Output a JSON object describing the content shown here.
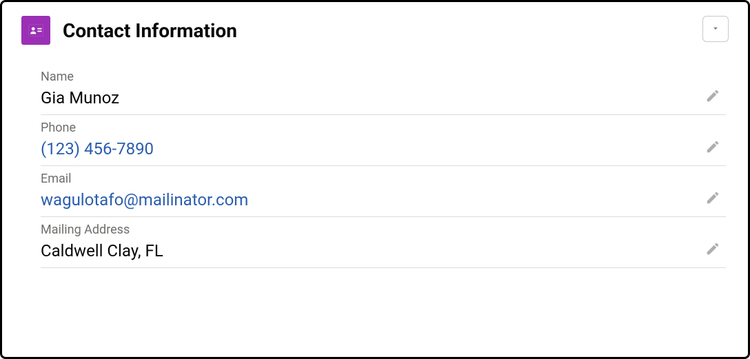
{
  "card": {
    "title": "Contact Information",
    "icon_name": "contact-card-icon"
  },
  "fields": [
    {
      "label": "Name",
      "value": "Gia Munoz",
      "is_link": false
    },
    {
      "label": "Phone",
      "value": "(123) 456-7890",
      "is_link": true
    },
    {
      "label": "Email",
      "value": "wagulotafo@mailinator.com",
      "is_link": true
    },
    {
      "label": "Mailing Address",
      "value": "Caldwell Clay, FL",
      "is_link": false
    }
  ]
}
